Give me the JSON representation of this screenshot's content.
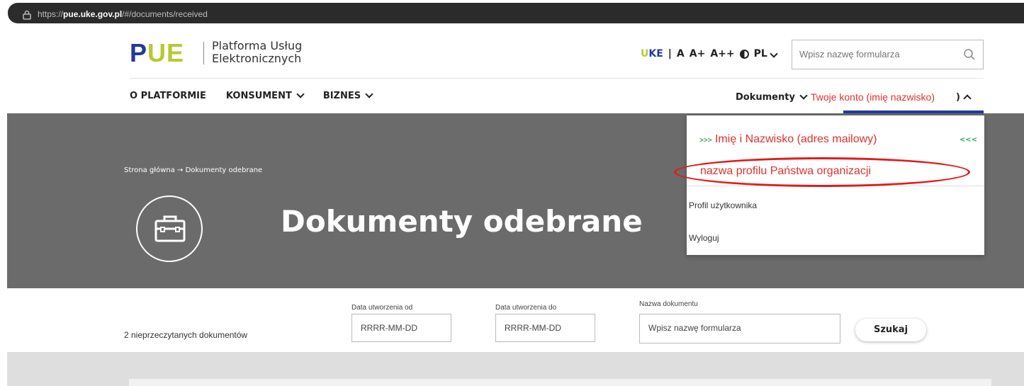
{
  "browser": {
    "url_prefix": "https://",
    "url_domain": "pue.uke.gov.pl",
    "url_path": "/#/documents/received"
  },
  "header": {
    "logo_p": "P",
    "logo_ue": "UE",
    "logo_line1": "Platforma Usług",
    "logo_line2": "Elektronicznych",
    "uke_u": "U",
    "uke_k": "KE",
    "sep": "|",
    "font_a": "A",
    "font_a_plus": "A+",
    "font_a_plusplus": "A++",
    "lang": "PL",
    "search_placeholder": "Wpisz nazwę formularza"
  },
  "nav": {
    "items": [
      "O PLATFORMIE",
      "KONSUMENT",
      "BIZNES"
    ],
    "documents": "Dokumenty",
    "account": "Twoje konto (imię nazwisko)",
    "account_paren": ")"
  },
  "hero": {
    "breadcrumb": "Strona główna → Dokumenty odebrane",
    "title": "Dokumenty odebrane"
  },
  "dropdown": {
    "arrows_left": ">>>",
    "arrows_right": "<<<",
    "user_name": "Imię i Nazwisko (adres mailowy)",
    "profile_name": "nazwa profilu Państwa organizacji",
    "profile_link": "Profil użytkownika",
    "logout": "Wyloguj"
  },
  "filters": {
    "unread": "2 nieprzeczytanych dokumentów",
    "from_label": "Data utworzenia od",
    "from_placeholder": "RRRR-MM-DD",
    "to_label": "Data utworzenia do",
    "to_placeholder": "RRRR-MM-DD",
    "name_label": "Nazwa dokumentu",
    "name_placeholder": "Wpisz nazwę formularza",
    "search_button": "Szukaj"
  },
  "colors": {
    "brand_blue": "#233a9a",
    "brand_green": "#b7c933",
    "highlight_red": "#e0312f",
    "hero_gray": "#6b6b6b"
  }
}
